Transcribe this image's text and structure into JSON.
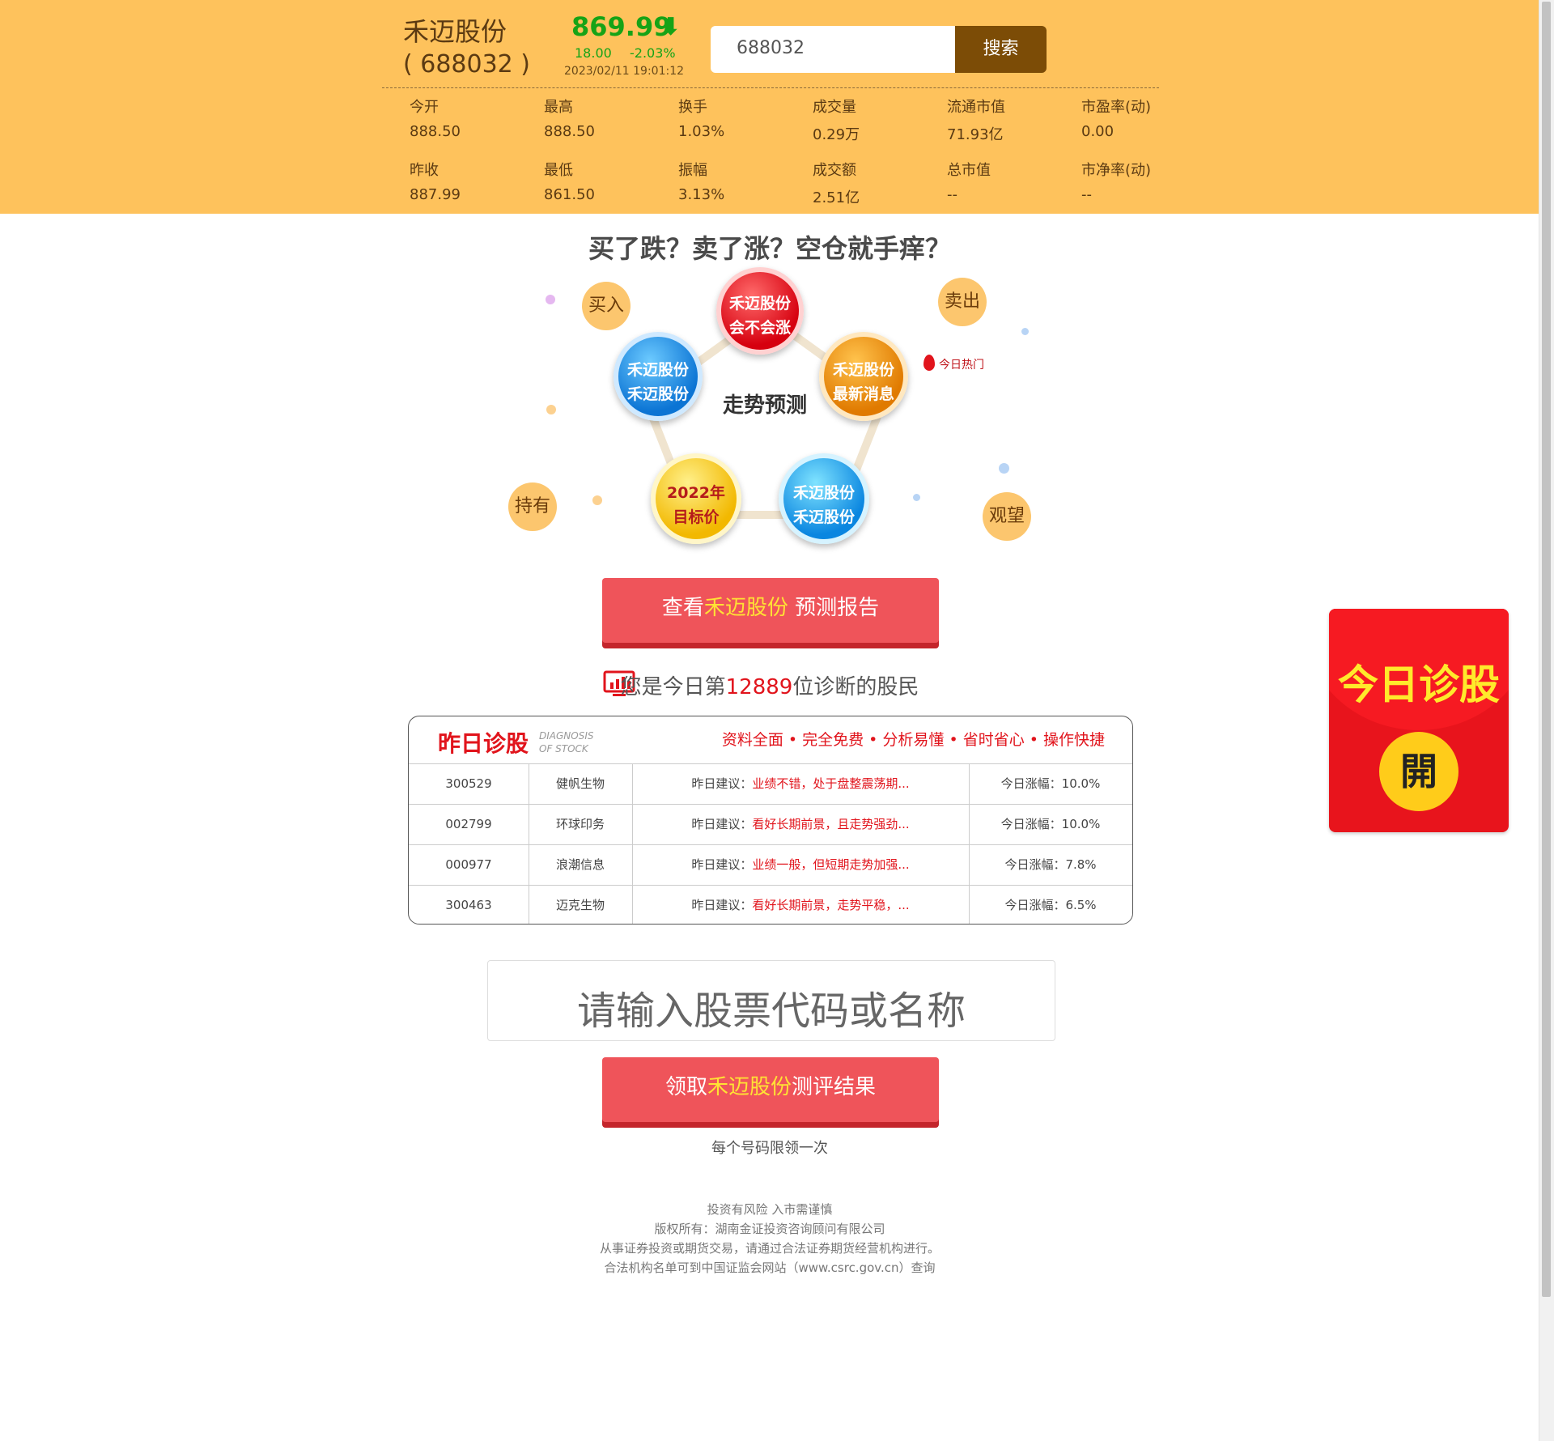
{
  "header": {
    "stock_name": "禾迈股份",
    "stock_code": "( 688032 )",
    "price": "869.99",
    "price_arrow_icon": "arrow-down-icon",
    "change": "18.00",
    "change_pct": "-2.03%",
    "datetime": "2023/02/11   19:01:12",
    "search_value": "688032",
    "search_button": "搜索",
    "stats_row1": [
      {
        "label": "今开",
        "value": "888.50"
      },
      {
        "label": "最高",
        "value": "888.50"
      },
      {
        "label": "换手",
        "value": "1.03%"
      },
      {
        "label": "成交量",
        "value": "0.29万"
      },
      {
        "label": "流通市值",
        "value": "71.93亿"
      },
      {
        "label": "市盈率(动)",
        "value": "0.00"
      }
    ],
    "stats_row2": [
      {
        "label": "昨收",
        "value": "887.99"
      },
      {
        "label": "最低",
        "value": "861.50"
      },
      {
        "label": "振幅",
        "value": "3.13%"
      },
      {
        "label": "成交额",
        "value": "2.51亿"
      },
      {
        "label": "总市值",
        "value": "--"
      },
      {
        "label": "市净率(动)",
        "value": "--"
      }
    ]
  },
  "banner": {
    "headline": "买了跌？卖了涨？空仓就手痒？",
    "center": "走势预测",
    "balls": {
      "top": [
        "禾迈股份",
        "会不会涨"
      ],
      "left": [
        "禾迈股份",
        "禾迈股份"
      ],
      "right": [
        "禾迈股份",
        "最新消息"
      ],
      "bottom_left": [
        "2022年",
        "目标价"
      ],
      "bottom_right": [
        "禾迈股份",
        "禾迈股份"
      ]
    },
    "bubbles": {
      "buy": "买入",
      "sell": "卖出",
      "hold": "持有",
      "watch": "观望"
    },
    "hot_tag": "今日热门"
  },
  "cta1": {
    "pre": "查看",
    "highlight": "禾迈股份",
    "post": " 预测报告"
  },
  "count_line": {
    "pre": "您是今日第",
    "num": "12889",
    "post": "位诊断的股民"
  },
  "table": {
    "title": "昨日诊股",
    "sub1": "DIAGNOSIS",
    "sub2": "OF STOCK",
    "tags": "资料全面 • 完全免费 • 分析易懂 • 省时省心 • 操作快捷",
    "rows": [
      {
        "code": "300529",
        "name": "健帆生物",
        "prefix": "昨日建议：",
        "advice": "业绩不错，处于盘整震荡期...",
        "rise": "今日涨幅：10.0%"
      },
      {
        "code": "002799",
        "name": "环球印务",
        "prefix": "昨日建议：",
        "advice": "看好长期前景，且走势强劲...",
        "rise": "今日涨幅：10.0%"
      },
      {
        "code": "000977",
        "name": "浪潮信息",
        "prefix": "昨日建议：",
        "advice": "业绩一般，但短期走势加强...",
        "rise": "今日涨幅：7.8%"
      },
      {
        "code": "300463",
        "name": "迈克生物",
        "prefix": "昨日建议：",
        "advice": "看好长期前景，走势平稳，...",
        "rise": "今日涨幅：6.5%"
      }
    ]
  },
  "stock_input_placeholder": "请输入股票代码或名称",
  "cta2": {
    "pre": "领取",
    "highlight": "禾迈股份",
    "post": "测评结果"
  },
  "limit_note": "每个号码限领一次",
  "footer": [
    "投资有风险 入市需谨慎",
    "版权所有：湖南金证投资咨询顾问有限公司",
    "从事证券投资或期货交易，请通过合法证券期货经营机构进行。",
    "合法机构名单可到中国证监会网站（www.csrc.gov.cn）查询"
  ],
  "packet": {
    "label": "今日诊股",
    "open": "開"
  },
  "colors": {
    "header_bg": "#fec25c",
    "accent_red": "#e1141c",
    "button_red": "#ef545a",
    "price_green": "#16a316",
    "search_btn": "#7c4c06"
  }
}
